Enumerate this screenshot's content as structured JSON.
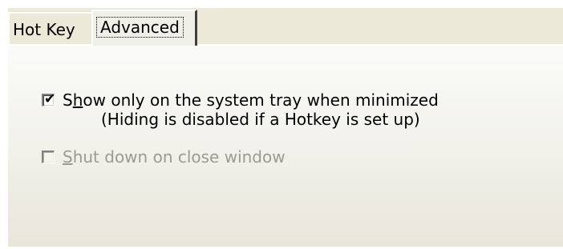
{
  "tabs": [
    {
      "label": "Hot Key",
      "selected": false
    },
    {
      "label": "Advanced",
      "selected": true
    }
  ],
  "options": {
    "tray": {
      "checked": true,
      "enabled": true,
      "label_prefix": "S",
      "label_mnemonic": "h",
      "label_rest": "ow only on the system tray when minimized",
      "note": "(Hiding is disabled if a Hotkey is set up)"
    },
    "shutdown": {
      "checked": false,
      "enabled": false,
      "label_mnemonic": "S",
      "label_rest": "hut down on close window"
    }
  },
  "check_glyph": "✔"
}
